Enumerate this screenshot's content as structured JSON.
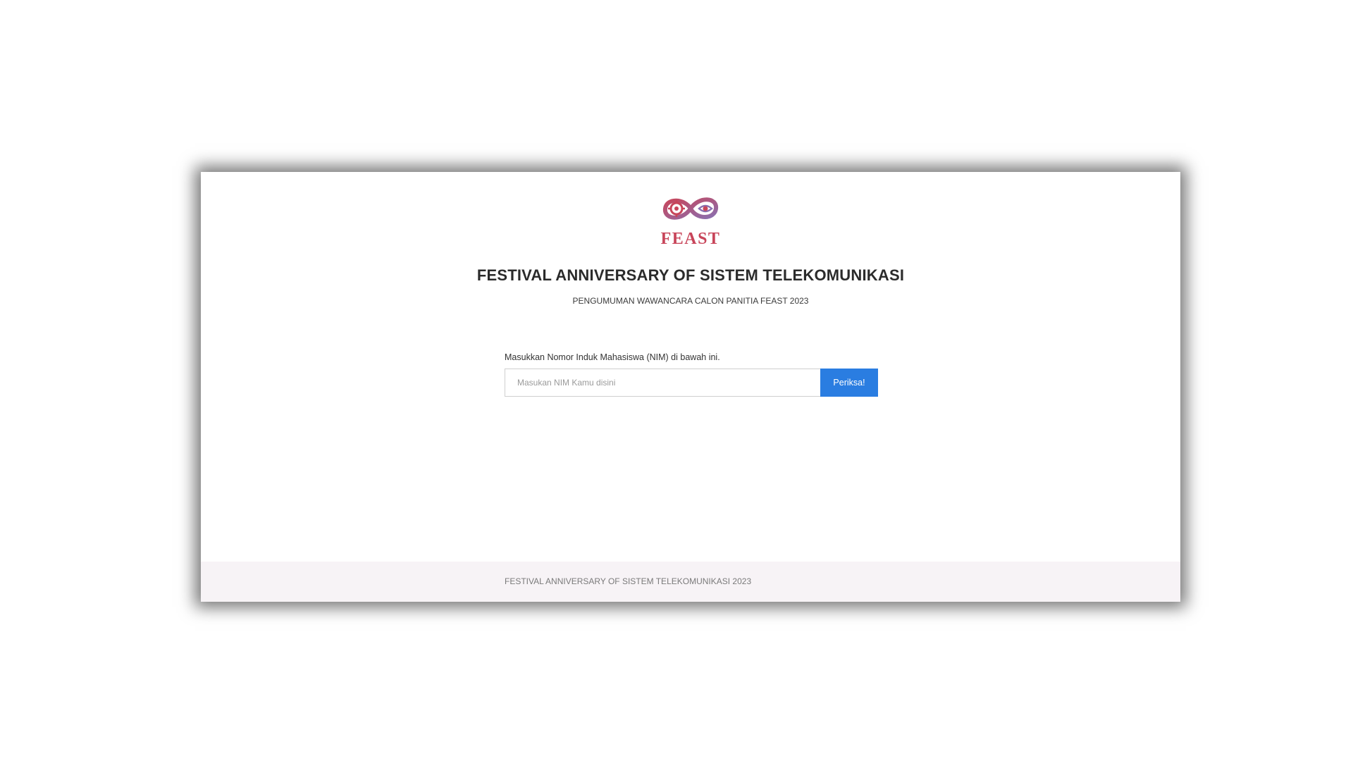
{
  "header": {
    "logo_text": "FEAST",
    "title": "FESTIVAL ANNIVERSARY OF SISTEM TELEKOMUNIKASI",
    "subtitle": "PENGUMUMAN WAWANCARA CALON PANITIA FEAST 2023"
  },
  "form": {
    "label": "Masukkan Nomor Induk Mahasiswa (NIM) di bawah ini.",
    "input_placeholder": "Masukan NIM Kamu disini",
    "input_value": "",
    "submit_label": "Periksa!"
  },
  "footer": {
    "text": "FESTIVAL ANNIVERSARY OF SISTEM TELEKOMUNIKASI 2023"
  },
  "colors": {
    "primary_button": "#2a7de1",
    "logo_red": "#c8455a",
    "logo_purple": "#8a6fb0",
    "footer_bg": "#f7f3f6"
  }
}
